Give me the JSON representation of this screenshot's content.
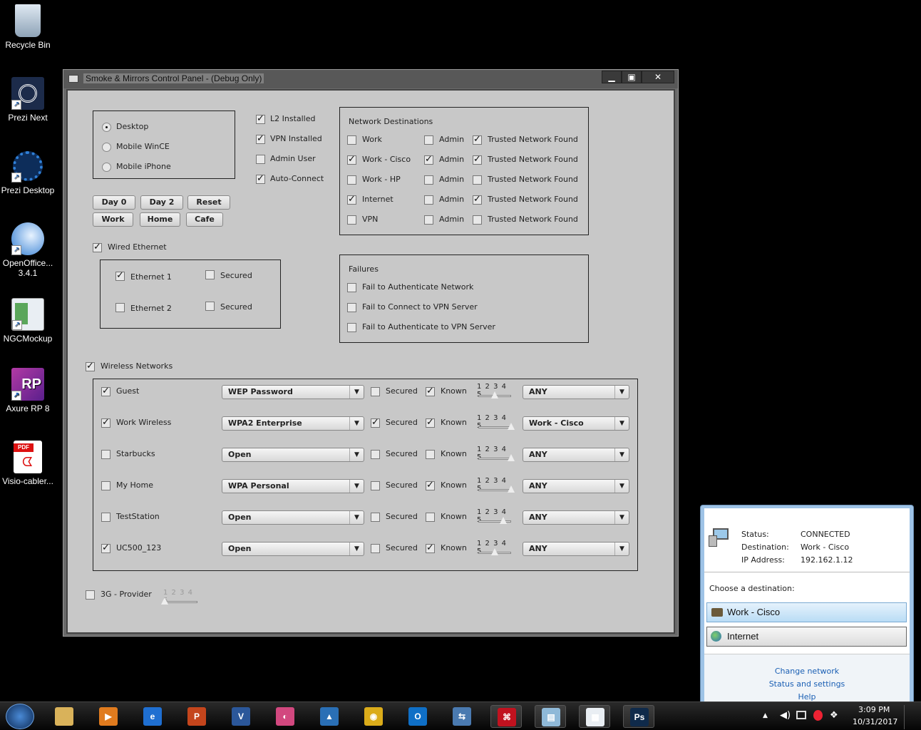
{
  "desktop": {
    "icons": [
      "Recycle Bin",
      "Prezi Next",
      "Prezi Desktop",
      "OpenOffice... 3.4.1",
      "NGCMockup",
      "Axure RP 8",
      "Visio-cabler..."
    ],
    "openoffice_line1": "OpenOffice...",
    "openoffice_line2": "3.4.1"
  },
  "window": {
    "title": "Smoke & Mirrors Control Panel - (Debug Only)",
    "min": "▁",
    "max": "▣",
    "close": "✕"
  },
  "platform": {
    "options": [
      "Desktop",
      "Mobile WinCE",
      "Mobile iPhone"
    ],
    "selected": "Desktop"
  },
  "install": {
    "items": [
      {
        "label": "L2 Installed",
        "checked": true
      },
      {
        "label": "VPN Installed",
        "checked": true
      },
      {
        "label": "Admin User",
        "checked": false
      },
      {
        "label": "Auto-Connect",
        "checked": true
      }
    ]
  },
  "presets": {
    "row1": [
      "Day 0",
      "Day 2",
      "Reset"
    ],
    "row2": [
      "Work",
      "Home",
      "Cafe"
    ]
  },
  "network_destinations": {
    "title": "Network Destinations",
    "rows": [
      {
        "name": "Work",
        "checked": false,
        "admin": false,
        "trusted": true
      },
      {
        "name": "Work - Cisco",
        "checked": true,
        "admin": true,
        "trusted": true
      },
      {
        "name": "Work - HP",
        "checked": false,
        "admin": false,
        "trusted": false
      },
      {
        "name": "Internet",
        "checked": true,
        "admin": false,
        "trusted": true
      },
      {
        "name": "VPN",
        "checked": false,
        "admin": false,
        "trusted": false
      }
    ],
    "admin_label": "Admin",
    "trusted_label": "Trusted Network Found"
  },
  "wired": {
    "label": "Wired Ethernet",
    "checked": true,
    "ports": [
      {
        "name": "Ethernet 1",
        "checked": true,
        "secured": false
      },
      {
        "name": "Ethernet 2",
        "checked": false,
        "secured": false
      }
    ],
    "secured_label": "Secured"
  },
  "failures": {
    "title": "Failures",
    "items": [
      "Fail to Authenticate Network",
      "Fail to Connect to VPN Server",
      "Fail to Authenticate to VPN Server"
    ]
  },
  "wireless": {
    "label": "Wireless Networks",
    "checked": true,
    "secured_label": "Secured",
    "known_label": "Known",
    "slider_nums": "1 2 3 4 5",
    "rows": [
      {
        "name": "Guest",
        "checked": true,
        "security": "WEP Password",
        "secured": false,
        "known": true,
        "signal": 3,
        "dest": "ANY"
      },
      {
        "name": "Work Wireless",
        "checked": true,
        "security": "WPA2 Enterprise",
        "secured": true,
        "known": true,
        "signal": 5,
        "dest": "Work - Cisco"
      },
      {
        "name": "Starbucks",
        "checked": false,
        "security": "Open",
        "secured": false,
        "known": false,
        "signal": 5,
        "dest": "ANY"
      },
      {
        "name": "My Home",
        "checked": false,
        "security": "WPA Personal",
        "secured": false,
        "known": true,
        "signal": 5,
        "dest": "ANY"
      },
      {
        "name": "TestStation",
        "checked": false,
        "security": "Open",
        "secured": false,
        "known": false,
        "signal": 4,
        "dest": "ANY"
      },
      {
        "name": "UC500_123",
        "checked": true,
        "security": "Open",
        "secured": false,
        "known": true,
        "signal": 3,
        "dest": "ANY"
      }
    ]
  },
  "provider": {
    "label": "3G - Provider",
    "checked": false,
    "signal": 1
  },
  "flyout": {
    "status_label": "Status:",
    "status_value": "CONNECTED",
    "destination_label": "Destination:",
    "destination_value": "Work - Cisco",
    "ip_label": "IP Address:",
    "ip_value": "192.162.1.12",
    "choose": "Choose a destination:",
    "networks": [
      "Work - Cisco",
      "Internet"
    ],
    "links": [
      "Change network",
      "Status and settings",
      "Help"
    ]
  },
  "taskbar": {
    "time": "3:09 PM",
    "date": "10/31/2017",
    "apps": [
      "explorer",
      "media",
      "ie",
      "powerpoint",
      "visio",
      "prezi",
      "axure",
      "chrome",
      "outlook",
      "network",
      "acrobat",
      "notepad",
      "ngc",
      "photoshop"
    ]
  },
  "colors": {
    "client_bg": "#c8c8c8",
    "flyout_border": "#9ec3e6",
    "link": "#1a5fb4"
  }
}
